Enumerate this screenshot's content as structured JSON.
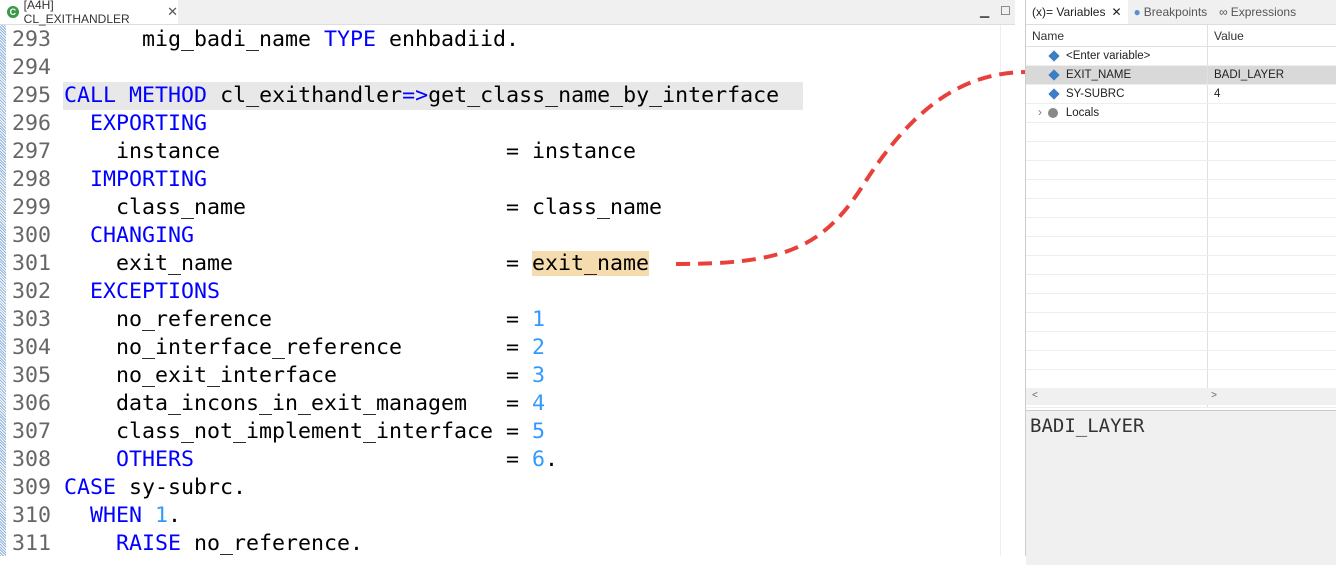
{
  "editor_tab": {
    "title": "[A4H] CL_EXITHANDLER",
    "icon": "class-icon"
  },
  "lines": [
    {
      "n": "293",
      "parts": [
        [
          "",
          "      mig_badi_name "
        ],
        [
          "kw",
          "TYPE"
        ],
        [
          "",
          "enhbadiid."
        ]
      ]
    },
    {
      "n": "294",
      "parts": []
    },
    {
      "n": "295",
      "parts": [
        [
          "kw",
          "CALL"
        ],
        [
          "kw",
          "METHOD"
        ],
        [
          "",
          "cl_exithandler"
        ],
        [
          "op",
          "=>"
        ],
        [
          "",
          "get_class_name_by_interface"
        ]
      ],
      "current": true
    },
    {
      "n": "296",
      "parts": [
        [
          "kw",
          "  EXPORTING"
        ]
      ]
    },
    {
      "n": "297",
      "parts": [
        [
          "",
          "    instance                      = instance"
        ]
      ]
    },
    {
      "n": "298",
      "parts": [
        [
          "kw",
          "  IMPORTING"
        ]
      ]
    },
    {
      "n": "299",
      "parts": [
        [
          "",
          "    class_name                    = class_name"
        ]
      ]
    },
    {
      "n": "300",
      "parts": [
        [
          "kw",
          "  CHANGING"
        ]
      ]
    },
    {
      "n": "301",
      "parts": [
        [
          "",
          "    exit_name                     = "
        ],
        [
          "mark",
          "exit_name"
        ]
      ]
    },
    {
      "n": "302",
      "parts": [
        [
          "kw",
          "  EXCEPTIONS"
        ]
      ]
    },
    {
      "n": "303",
      "parts": [
        [
          "",
          "    no_reference                  = "
        ],
        [
          "num",
          "1"
        ]
      ]
    },
    {
      "n": "304",
      "parts": [
        [
          "",
          "    no_interface_reference        = "
        ],
        [
          "num",
          "2"
        ]
      ]
    },
    {
      "n": "305",
      "parts": [
        [
          "",
          "    no_exit_interface             = "
        ],
        [
          "num",
          "3"
        ]
      ]
    },
    {
      "n": "306",
      "parts": [
        [
          "",
          "    data_incons_in_exit_managem   = "
        ],
        [
          "num",
          "4"
        ]
      ]
    },
    {
      "n": "307",
      "parts": [
        [
          "",
          "    class_not_implement_interface = "
        ],
        [
          "num",
          "5"
        ]
      ]
    },
    {
      "n": "308",
      "parts": [
        [
          "kw",
          "    OTHERS"
        ],
        [
          "",
          "                        = "
        ],
        [
          "num",
          "6"
        ],
        [
          "",
          "."
        ]
      ]
    },
    {
      "n": "309",
      "parts": [
        [
          "kw",
          "CASE"
        ],
        [
          "",
          "sy-subrc."
        ]
      ]
    },
    {
      "n": "310",
      "parts": [
        [
          "kw",
          "  WHEN"
        ],
        [
          "num",
          "1"
        ],
        [
          "",
          "."
        ]
      ]
    },
    {
      "n": "311",
      "parts": [
        [
          "kw",
          "    RAISE"
        ],
        [
          "",
          "no_reference."
        ]
      ]
    }
  ],
  "panel": {
    "tabs": [
      {
        "label": "(x)= Variables"
      },
      {
        "label": "Breakpoints"
      },
      {
        "label": "Expressions"
      }
    ],
    "columns": {
      "name": "Name",
      "value": "Value"
    },
    "rows": [
      {
        "name": "<Enter variable>",
        "value": ""
      },
      {
        "name": "EXIT_NAME",
        "value": "BADI_LAYER",
        "selected": true
      },
      {
        "name": "SY-SUBRC",
        "value": "4"
      },
      {
        "name": "Locals",
        "value": ""
      }
    ],
    "detail": "BADI_LAYER"
  },
  "colors": {
    "annotation": "#e8403a",
    "keyword": "#0000ff",
    "number": "#3399ff"
  }
}
